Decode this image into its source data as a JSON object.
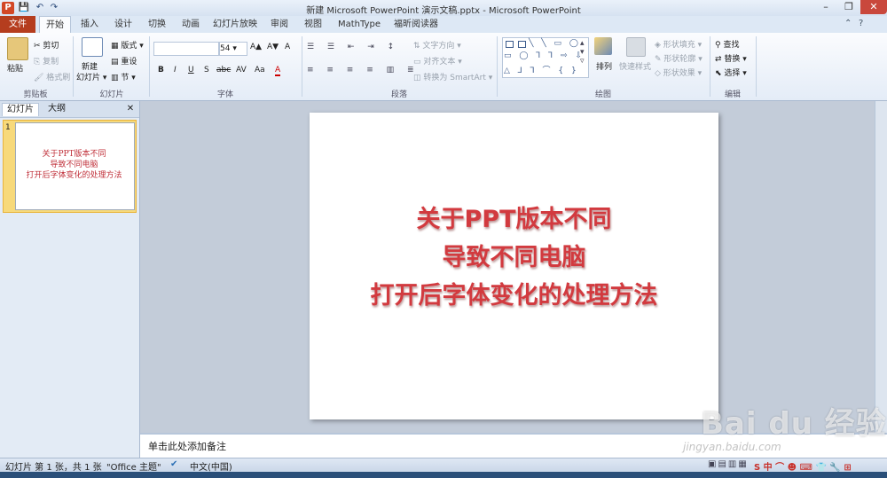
{
  "window": {
    "title": "新建 Microsoft PowerPoint 演示文稿.pptx - Microsoft PowerPoint",
    "logo": "P",
    "controls": [
      "–",
      "❐",
      "✕"
    ]
  },
  "tabs": {
    "file": "文件",
    "items": [
      "开始",
      "插入",
      "设计",
      "切换",
      "动画",
      "幻灯片放映",
      "审阅",
      "视图",
      "MathType",
      "福昕阅读器"
    ]
  },
  "ribbon": {
    "clipboard": {
      "paste": "粘贴",
      "cut": "剪切",
      "copy": "复制",
      "format_painter": "格式刷",
      "label": "剪贴板"
    },
    "slides": {
      "new_slide_1": "新建",
      "new_slide_2": "幻灯片 ▾",
      "layout": "版式 ▾",
      "reset": "重设",
      "section": "节 ▾",
      "label": "幻灯片"
    },
    "font": {
      "size": "54",
      "bold": "B",
      "italic": "I",
      "underline": "U",
      "strike": "S",
      "shadow": "abc",
      "spacing": "AV",
      "case": "Aa",
      "color": "A",
      "grow": "A▲",
      "shrink": "A▼",
      "clear": "A",
      "label": "字体"
    },
    "paragraph": {
      "text_direction": "文字方向 ▾",
      "align_text": "对齐文本 ▾",
      "smartart": "转换为 SmartArt ▾",
      "label": "段落"
    },
    "drawing": {
      "arrange": "排列",
      "quick_styles": "快速样式",
      "fill": "形状填充 ▾",
      "outline": "形状轮廓 ▾",
      "effects": "形状效果 ▾",
      "label": "绘图"
    },
    "editing": {
      "find": "查找",
      "replace": "替换 ▾",
      "select": "选择 ▾",
      "label": "编辑"
    }
  },
  "left_pane": {
    "tab_slides": "幻灯片",
    "tab_outline": "大纲",
    "close": "✕",
    "slide_number": "1",
    "thumb_lines": [
      "关于PPT版本不同",
      "导致不同电脑",
      "打开后字体变化的处理方法"
    ]
  },
  "slide": {
    "lines": [
      "关于PPT版本不同",
      "导致不同电脑",
      "打开后字体变化的处理方法"
    ]
  },
  "notes": {
    "placeholder": "单击此处添加备注"
  },
  "statusbar": {
    "slide_info": "幻灯片 第 1 张，共 1 张",
    "theme": "\"Office 主题\"",
    "language": "中文(中国)",
    "ime": "S 中 ⌒ ☻ ⌨ 👕 🔧 ⊞"
  },
  "watermark": {
    "logo": "Bai du 经验",
    "url": "jingyan.baidu.com"
  },
  "colors": {
    "accent": "#b53d1e",
    "slide_text": "#d23a3f",
    "thumb_selected": "#f7d97a"
  }
}
